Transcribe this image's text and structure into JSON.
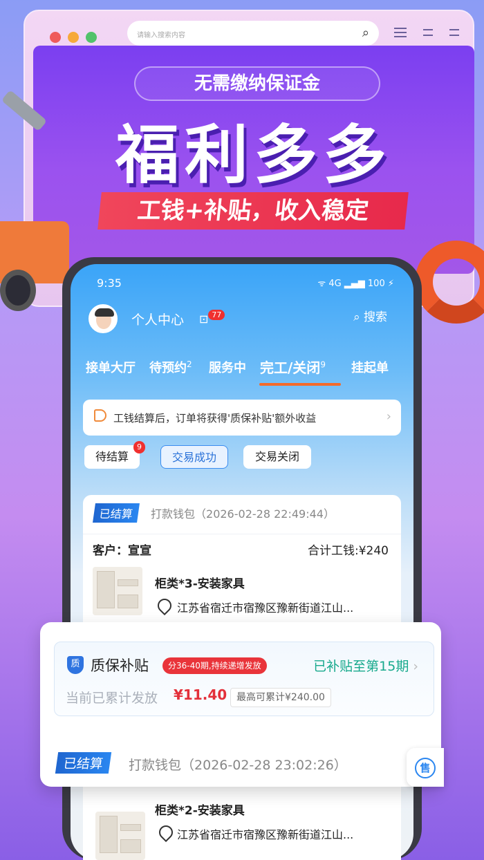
{
  "browser": {
    "address_placeholder": "请输入搜索内容"
  },
  "banner": {
    "pill": "无需缴纳保证金",
    "headline": "福利多多",
    "subline": "工钱+补贴，收入稳定"
  },
  "status": {
    "time": "9:35",
    "right": "ᯤ 4G ▂▄▆ 100 ⚡"
  },
  "header": {
    "username": "个人中心",
    "message_count": "77",
    "search_label": "搜索"
  },
  "tabs": [
    {
      "label": "接单大厅",
      "count": ""
    },
    {
      "label": "待预约",
      "count": "2"
    },
    {
      "label": "服务中",
      "count": ""
    },
    {
      "label": "完工/关闭",
      "count": "9"
    },
    {
      "label": "挂起单",
      "count": ""
    }
  ],
  "notice": {
    "text": "工钱结算后，订单将获得'质保补贴'额外收益"
  },
  "chips": [
    {
      "label": "待结算",
      "badge": "9"
    },
    {
      "label": "交易成功",
      "badge": ""
    },
    {
      "label": "交易关闭",
      "badge": ""
    }
  ],
  "order1": {
    "tag": "已结算",
    "channel": "打款钱包",
    "time": "（2026-02-28 22:49:44）",
    "customer_label": "客户：",
    "customer": "宣宣",
    "total": "合计工钱:¥240",
    "item": "柜类*3-安装家具",
    "address": "江苏省宿迁市宿豫区豫新街道江山..."
  },
  "subsidy": {
    "shield": "质",
    "title": "质保补贴",
    "period": "分36-40期,持续递增发放",
    "progress": "已补贴至第15期",
    "cumulative_label": "当前已累计发放",
    "amount": "¥11.40",
    "max": "最高可累计¥240.00"
  },
  "order2": {
    "tag": "已结算",
    "channel": "打款钱包",
    "time": "（2026-02-28 23:02:26）"
  },
  "order3": {
    "item": "柜类*2-安装家具",
    "address": "江苏省宿迁市宿豫区豫新街道江山..."
  },
  "float": {
    "label": "售"
  },
  "icons": {
    "search": "search-icon",
    "chevron": "chevron-right-icon",
    "location": "location-icon",
    "speaker": "speaker-icon"
  }
}
